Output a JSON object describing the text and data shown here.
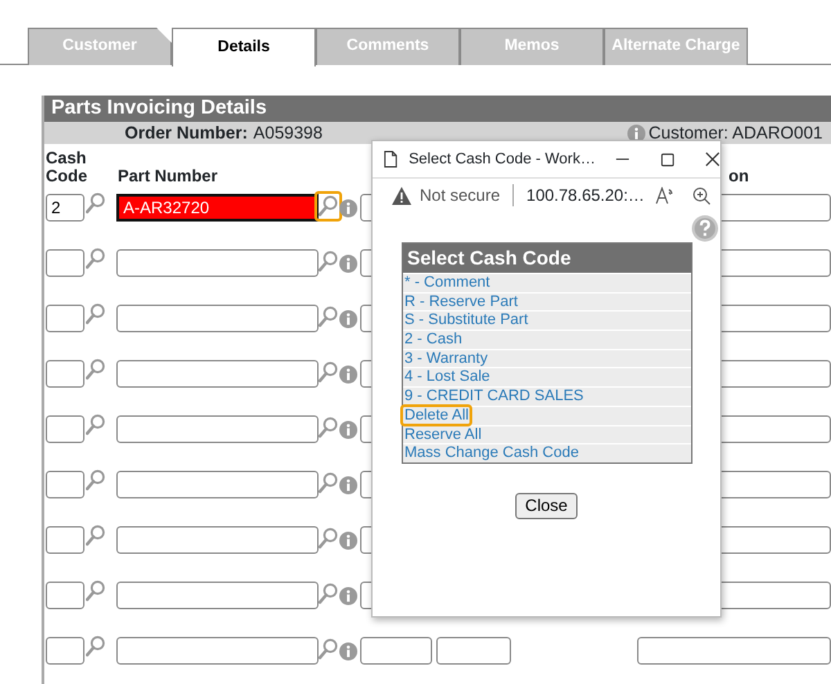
{
  "tabs": [
    {
      "label": "Customer",
      "selected": false
    },
    {
      "label": "Details",
      "selected": true
    },
    {
      "label": "Comments",
      "selected": false
    },
    {
      "label": "Memos",
      "selected": false
    },
    {
      "label": "Alternate Charge",
      "selected": false
    }
  ],
  "panel": {
    "title": "Parts Invoicing Details",
    "order_label": "Order Number:",
    "order_number": "A059398",
    "customer": "Customer: ADARO001"
  },
  "columns": [
    {
      "label": "Cash Code"
    },
    {
      "label": "Part Number"
    },
    {
      "label": "on"
    }
  ],
  "rows": [
    {
      "cash_code": "2",
      "part_number": "A-AR32720",
      "error": true,
      "lookup_highlighted": true
    },
    {
      "error": false,
      "lookup_highlighted": false
    },
    {
      "error": false,
      "lookup_highlighted": false
    },
    {
      "error": false,
      "lookup_highlighted": false
    },
    {
      "error": false,
      "lookup_highlighted": false
    },
    {
      "error": false,
      "lookup_highlighted": false
    },
    {
      "error": false,
      "lookup_highlighted": false
    },
    {
      "error": false,
      "lookup_highlighted": false
    },
    {
      "error": false,
      "lookup_highlighted": false
    }
  ],
  "popup": {
    "title": "Select Cash Code - Work…",
    "security": "Not secure",
    "url": "100.78.65.20:…",
    "heading": "Select Cash Code",
    "close": "Close",
    "options": [
      {
        "label": "* - Comment",
        "highlighted": false
      },
      {
        "label": "R - Reserve Part",
        "highlighted": false
      },
      {
        "label": "S - Substitute Part",
        "highlighted": false
      },
      {
        "label": "2 - Cash",
        "highlighted": false
      },
      {
        "label": "3 - Warranty",
        "highlighted": false
      },
      {
        "label": "4 - Lost Sale",
        "highlighted": false
      },
      {
        "label": "9 - CREDIT CARD SALES",
        "highlighted": false
      },
      {
        "label": "Delete All",
        "highlighted": true
      },
      {
        "label": "Reserve All",
        "highlighted": false
      },
      {
        "label": "Mass Change Cash Code",
        "highlighted": false
      }
    ]
  }
}
